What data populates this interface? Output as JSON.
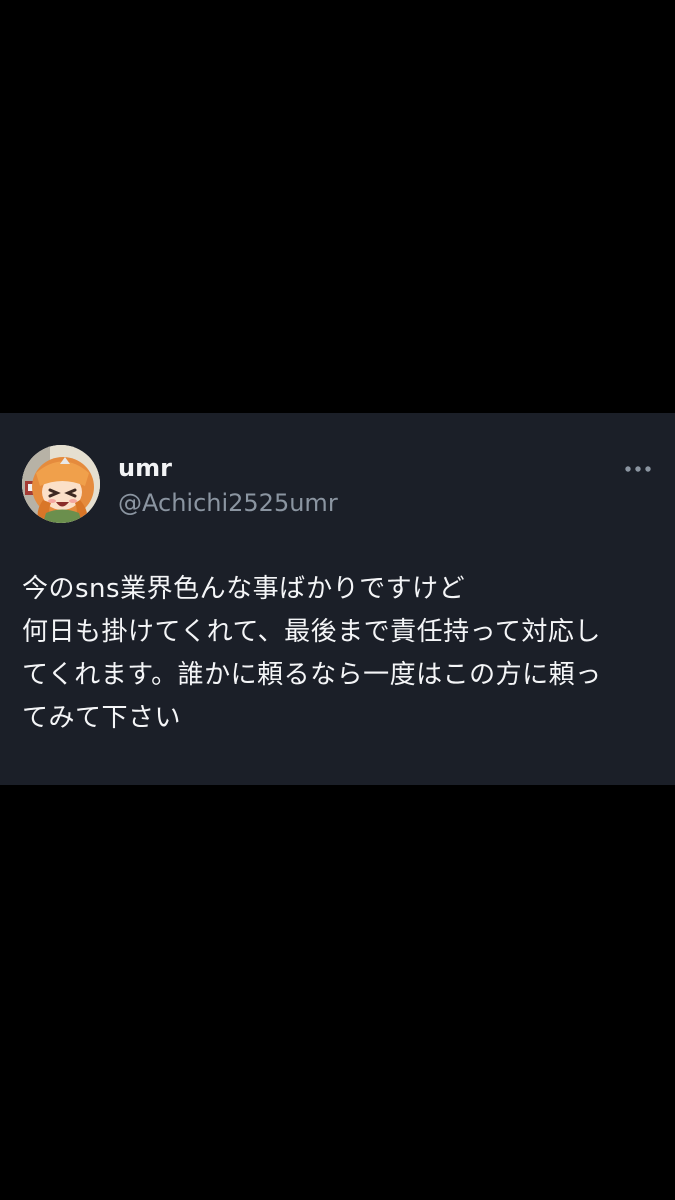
{
  "app": {
    "background_color": "#000000",
    "card_color": "#1b1f28",
    "accent_text_color": "#f4f5f7",
    "muted_text_color": "#8b95a1"
  },
  "tweet": {
    "author": {
      "display_name": "umr",
      "handle": "@Achichi2525umr",
      "avatar_icon": "anime-character-avatar"
    },
    "more_icon": "more-horizontal-icon",
    "text_lines": [
      "今のsns業界色んな事ばかりですけど",
      "何日も掛けてくれて、最後まで責任持って対応し",
      "てくれます。誰かに頼るなら一度はこの方に頼っ",
      "てみて下さい"
    ]
  }
}
